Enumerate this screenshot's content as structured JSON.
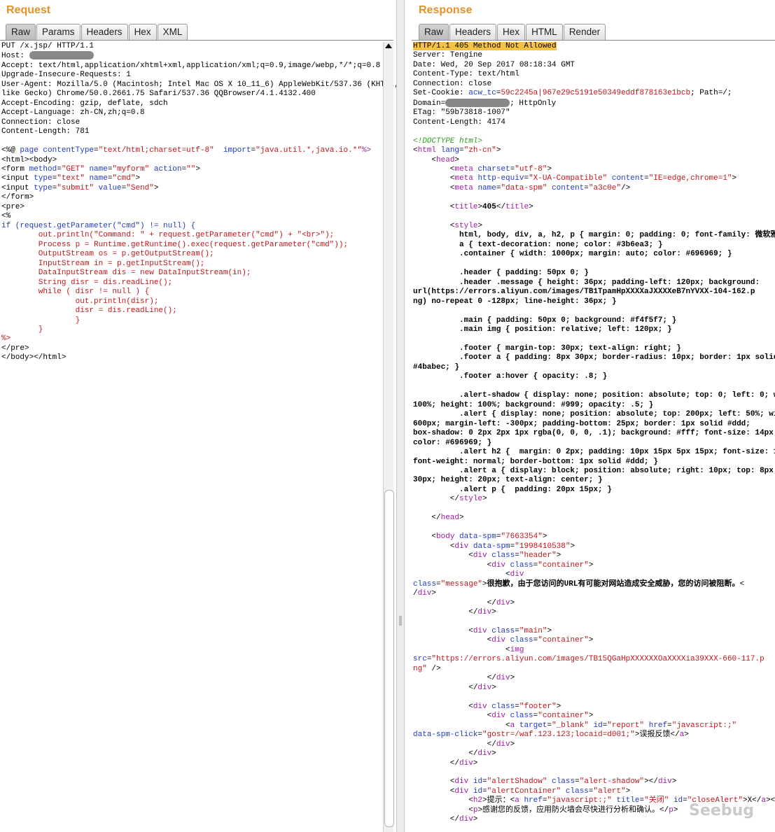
{
  "request": {
    "title": "Request",
    "tabs": [
      "Raw",
      "Params",
      "Headers",
      "Hex",
      "XML"
    ],
    "active_tab": "Raw"
  },
  "response": {
    "title": "Response",
    "tabs": [
      "Raw",
      "Headers",
      "Hex",
      "HTML",
      "Render"
    ],
    "active_tab": "Raw"
  },
  "watermark": "Seebug"
}
